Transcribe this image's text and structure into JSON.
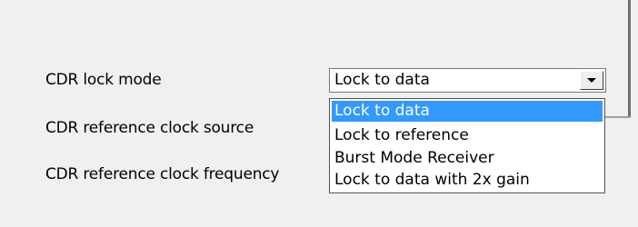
{
  "form": {
    "rows": [
      {
        "label": "CDR lock mode"
      },
      {
        "label": "CDR reference clock source"
      },
      {
        "label": "CDR reference clock frequency"
      }
    ],
    "lock_mode_combo": {
      "value": "Lock to data",
      "options": [
        "Lock to data",
        "Lock to reference",
        "Burst Mode Receiver",
        "Lock to data with 2x gain"
      ],
      "highlighted_index": 0
    }
  },
  "colors": {
    "window_bg": "#f0f0f0",
    "highlight_bg": "#3399ff",
    "highlight_text": "#ffffff"
  }
}
